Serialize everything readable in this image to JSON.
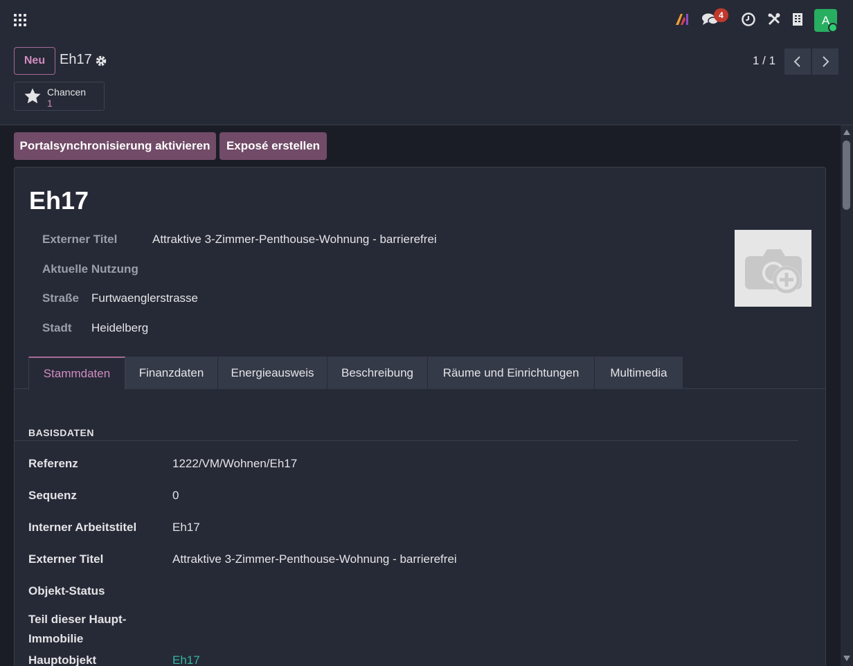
{
  "navbar": {
    "apps_icon": "apps-grid-icon",
    "messages_badge": "4",
    "avatar_letter": "A"
  },
  "control_panel": {
    "new_button": "Neu",
    "record_name": "Eh17",
    "pager": "1 / 1",
    "smart_button": {
      "label": "Chancen",
      "value": "1"
    }
  },
  "header_buttons": {
    "portal_sync": "Portalsynchronisierung aktivieren",
    "create_expose": "Exposé erstellen"
  },
  "sheet": {
    "title": "Eh17",
    "fields": [
      {
        "label": "Externer Titel",
        "value": "Attraktive 3-Zimmer-Penthouse-Wohnung - barrierefrei"
      },
      {
        "label": "Aktuelle Nutzung",
        "value": ""
      },
      {
        "label": "Straße",
        "value": "Furtwaenglerstrasse"
      },
      {
        "label": "Stadt",
        "value": "Heidelberg"
      }
    ]
  },
  "tabs": [
    "Stammdaten",
    "Finanzdaten",
    "Energieausweis",
    "Beschreibung",
    "Räume und Einrichtungen",
    "Multimedia"
  ],
  "active_tab": "Stammdaten",
  "basisdaten": {
    "section_title": "BASISDATEN",
    "rows": [
      {
        "label": "Referenz",
        "value": "1222/VM/Wohnen/Eh17"
      },
      {
        "label": "Sequenz",
        "value": "0"
      },
      {
        "label": "Interner Arbeitstitel",
        "value": "Eh17"
      },
      {
        "label": "Externer Titel",
        "value": "Attraktive 3-Zimmer-Penthouse-Wohnung - barrierefrei"
      },
      {
        "label": "Objekt-Status",
        "value": ""
      },
      {
        "label": "Teil dieser Haupt-Immobilie",
        "value": ""
      },
      {
        "label": "Hauptobjekt",
        "value": "Eh17"
      }
    ]
  },
  "colors": {
    "accent": "#714b67",
    "accent_text": "#d18cc1",
    "link": "#35b5a4",
    "background": "#262a36"
  }
}
